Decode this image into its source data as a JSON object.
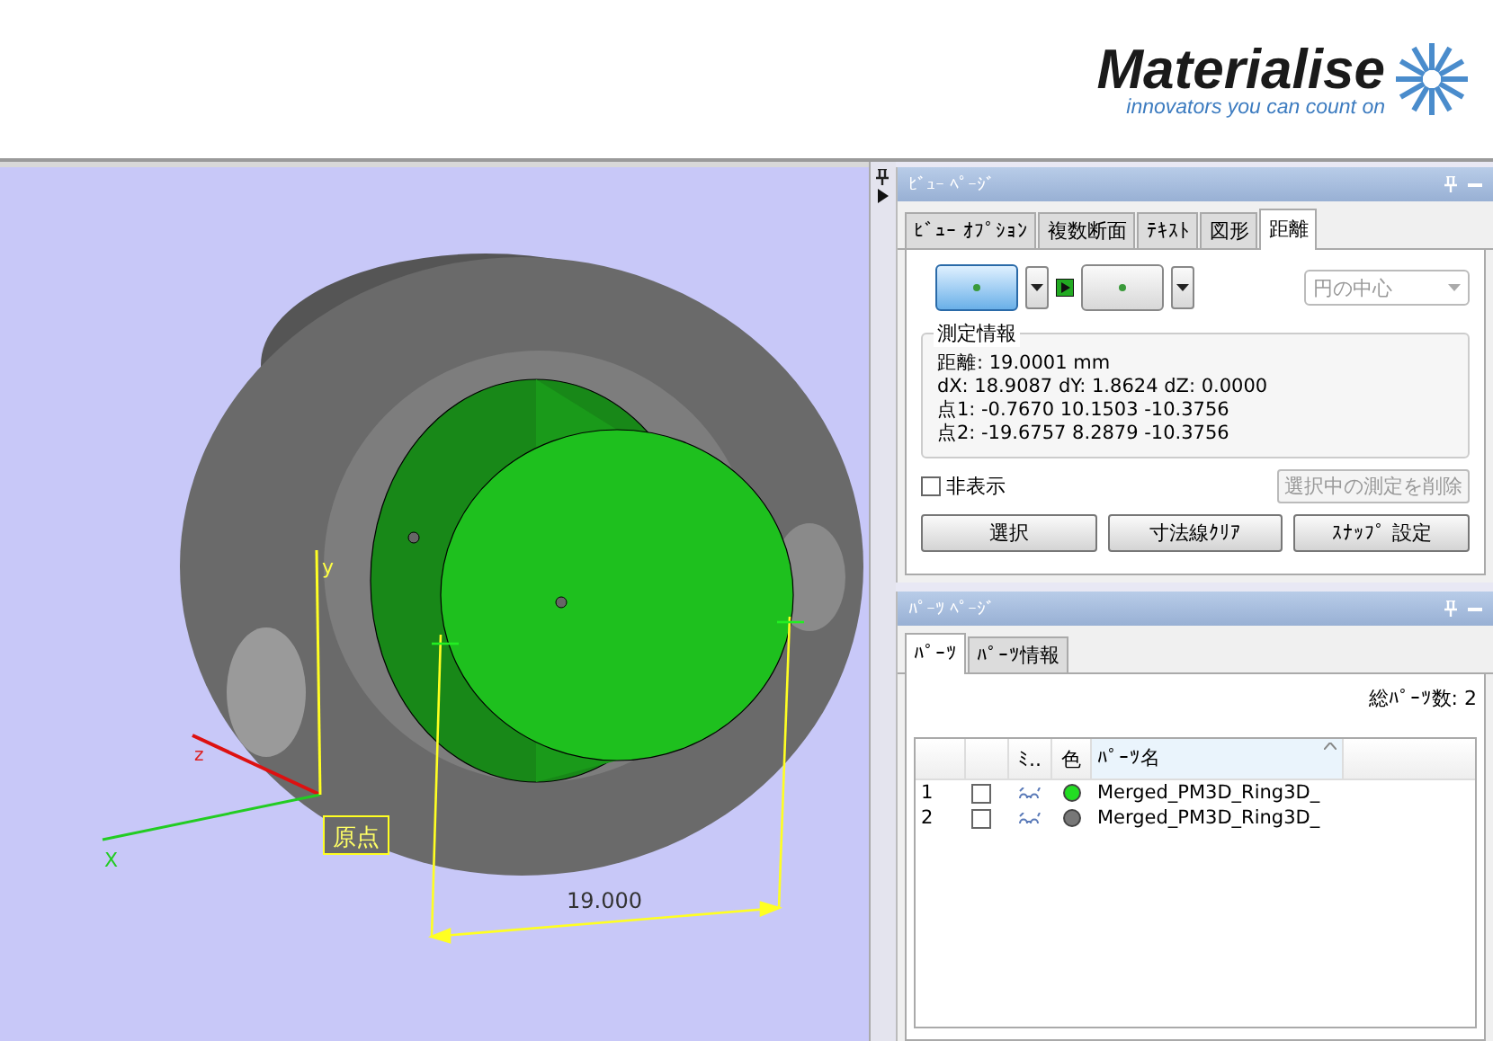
{
  "logo": {
    "name": "Materialise",
    "tagline": "innovators you can count on"
  },
  "viewport": {
    "axis_labels": {
      "y": "y",
      "z": "z",
      "x": "X"
    },
    "origin_label": "原点",
    "dimension": "19.000"
  },
  "view_page": {
    "title": "ﾋﾞｭｰ ﾍﾟｰｼﾞ",
    "tabs": [
      {
        "label": "ﾋﾞｭｰ ｵﾌﾟｼｮﾝ",
        "selected": false
      },
      {
        "label": "複数断面",
        "selected": false
      },
      {
        "label": "ﾃｷｽﾄ",
        "selected": false
      },
      {
        "label": "図形",
        "selected": false
      },
      {
        "label": "距離",
        "selected": true
      }
    ],
    "point_buttons": [
      {
        "selected": true
      },
      {
        "selected": false
      }
    ],
    "snap_mode": {
      "value": "円の中心",
      "disabled": true
    },
    "info": {
      "title": "測定情報",
      "lines": [
        "距離: 19.0001 mm",
        "dX: 18.9087 dY: 1.8624 dZ: 0.0000",
        "点1: -0.7670  10.1503  -10.3756",
        "点2: -19.6757 8.2879  -10.3756"
      ]
    },
    "hide": {
      "label": "非表示",
      "checked": false
    },
    "delete_button": {
      "label": "選択中の測定を削除",
      "disabled": true
    },
    "buttons": [
      "選択",
      "寸法線ｸﾘｱ",
      "ｽﾅｯﾌﾟ 設定"
    ]
  },
  "parts_page": {
    "title": "ﾊﾟｰﾂ ﾍﾟｰｼﾞ",
    "tabs": [
      {
        "label": "ﾊﾟｰﾂ",
        "selected": true
      },
      {
        "label": "ﾊﾟｰﾂ情報",
        "selected": false
      }
    ],
    "total": "総ﾊﾟｰﾂ数: 2",
    "table": {
      "columns": [
        "ﾐ..",
        "色",
        "ﾊﾟｰﾂ名"
      ],
      "rows": [
        {
          "index": "1",
          "checked": false,
          "color": "#22dd22",
          "name": "Merged_PM3D_Ring3D_"
        },
        {
          "index": "2",
          "checked": false,
          "color": "#777777",
          "name": "Merged_PM3D_Ring3D_"
        }
      ]
    }
  }
}
